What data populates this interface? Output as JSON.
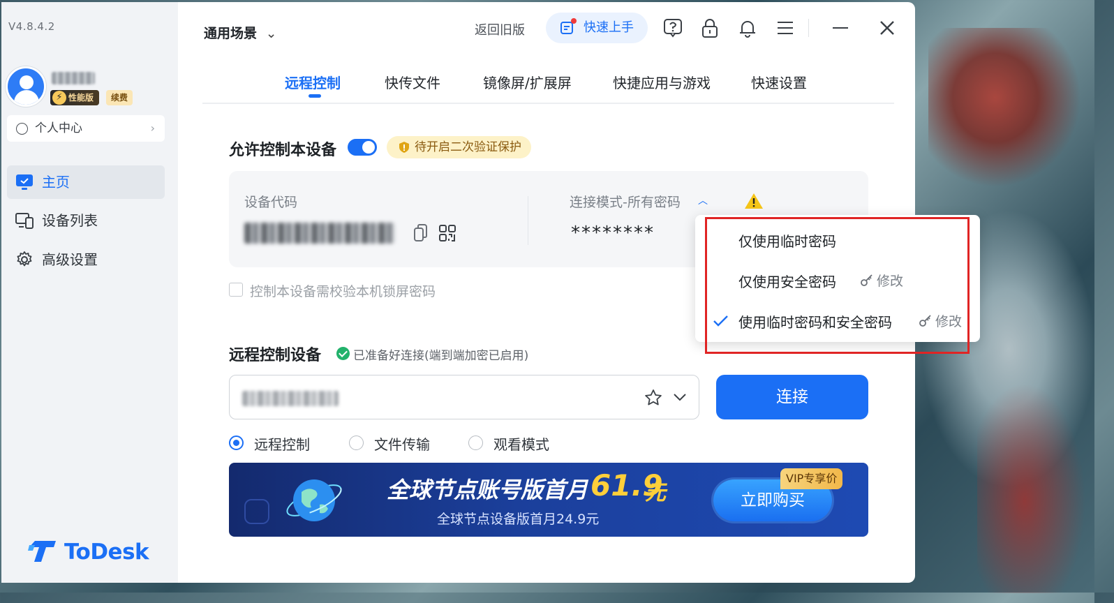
{
  "app": {
    "version": "V4.8.4.2",
    "logo_text": "ToDesk",
    "brand_color": "#1b6ff5"
  },
  "sidebar": {
    "badge_performance": "性能版",
    "badge_renew": "续费",
    "personal_center": "个人中心",
    "items": [
      {
        "label": "主页",
        "icon": "monitor-icon",
        "active": true
      },
      {
        "label": "设备列表",
        "icon": "devices-icon",
        "active": false
      },
      {
        "label": "高级设置",
        "icon": "gear-icon",
        "active": false
      }
    ]
  },
  "header": {
    "scene_label": "通用场景",
    "back_old": "返回旧版",
    "quick_start": "快速上手",
    "icons": [
      "help-icon",
      "lock-icon",
      "bell-icon",
      "menu-icon",
      "minimize-icon",
      "close-icon"
    ]
  },
  "tabs": [
    {
      "label": "远程控制",
      "active": true
    },
    {
      "label": "快传文件",
      "active": false
    },
    {
      "label": "镜像屏/扩展屏",
      "active": false
    },
    {
      "label": "快捷应用与游戏",
      "active": false
    },
    {
      "label": "快速设置",
      "active": false
    }
  ],
  "allow_control": {
    "title": "允许控制本设备",
    "enabled": true,
    "warning": "待开启二次验证保护"
  },
  "device_card": {
    "code_label": "设备代码",
    "mode_label": "连接模式-所有密码",
    "password_mask": "********"
  },
  "lock_check": {
    "label": "控制本设备需校验本机锁屏密码",
    "checked": false
  },
  "remote": {
    "title": "远程控制设备",
    "status": "已准备好连接(端到端加密已启用)",
    "connect": "连接",
    "modes": [
      {
        "label": "远程控制",
        "selected": true
      },
      {
        "label": "文件传输",
        "selected": false
      },
      {
        "label": "观看模式",
        "selected": false
      }
    ]
  },
  "banner": {
    "main_text": "全球节点账号版首月",
    "price": "61.9",
    "unit": "元",
    "sub_text": "全球节点设备版首月24.9元",
    "buy": "立即购买",
    "vip_tag": "VIP专享价"
  },
  "dropdown": {
    "options": [
      {
        "label": "仅使用临时密码",
        "edit": "",
        "checked": false
      },
      {
        "label": "仅使用安全密码",
        "edit": "修改",
        "checked": false
      },
      {
        "label": "使用临时密码和安全密码",
        "edit": "修改",
        "checked": true
      }
    ]
  }
}
